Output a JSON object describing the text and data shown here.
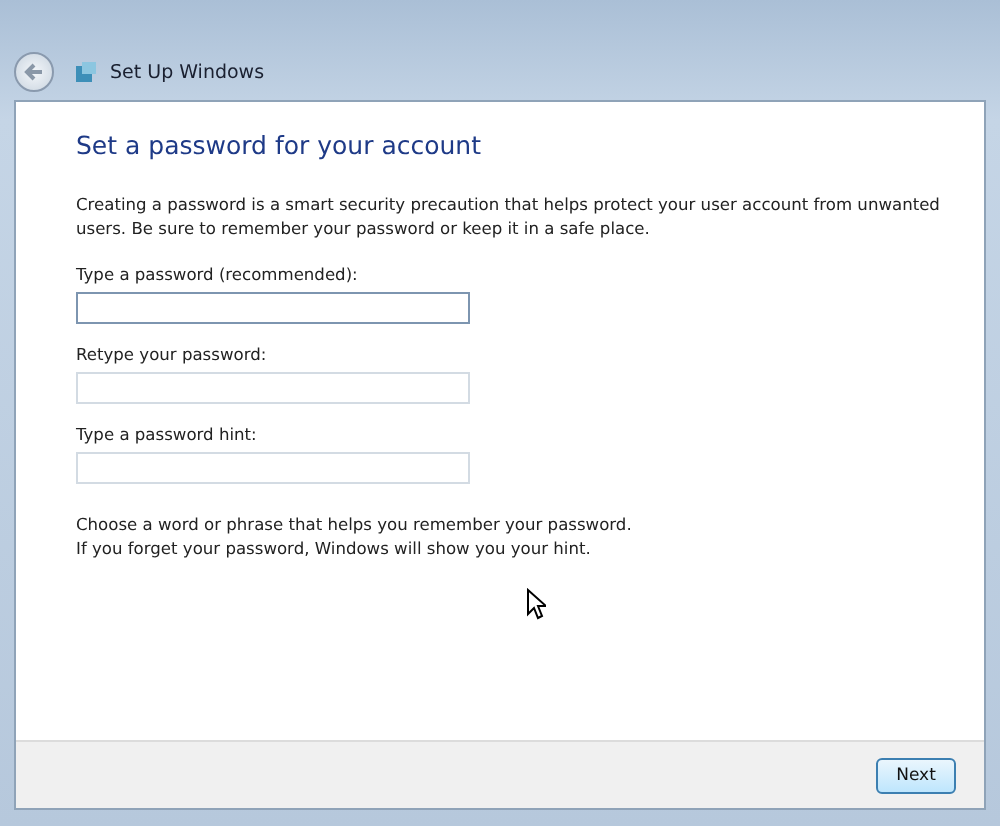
{
  "window": {
    "title": "Set Up Windows"
  },
  "heading": "Set a password for your account",
  "intro": "Creating a password is a smart security precaution that helps protect your user account from unwanted users. Be sure to remember your password or keep it in a safe place.",
  "fields": [
    {
      "label": "Type a password (recommended):",
      "focused": true
    },
    {
      "label": "Retype your password:",
      "focused": false
    },
    {
      "label": "Type a password hint:",
      "focused": false
    }
  ],
  "hint_note": [
    "Choose a word or phrase that helps you remember your password.",
    "If you forget your password, Windows will show you your hint."
  ],
  "buttons": [
    {
      "label": "Next"
    }
  ]
}
